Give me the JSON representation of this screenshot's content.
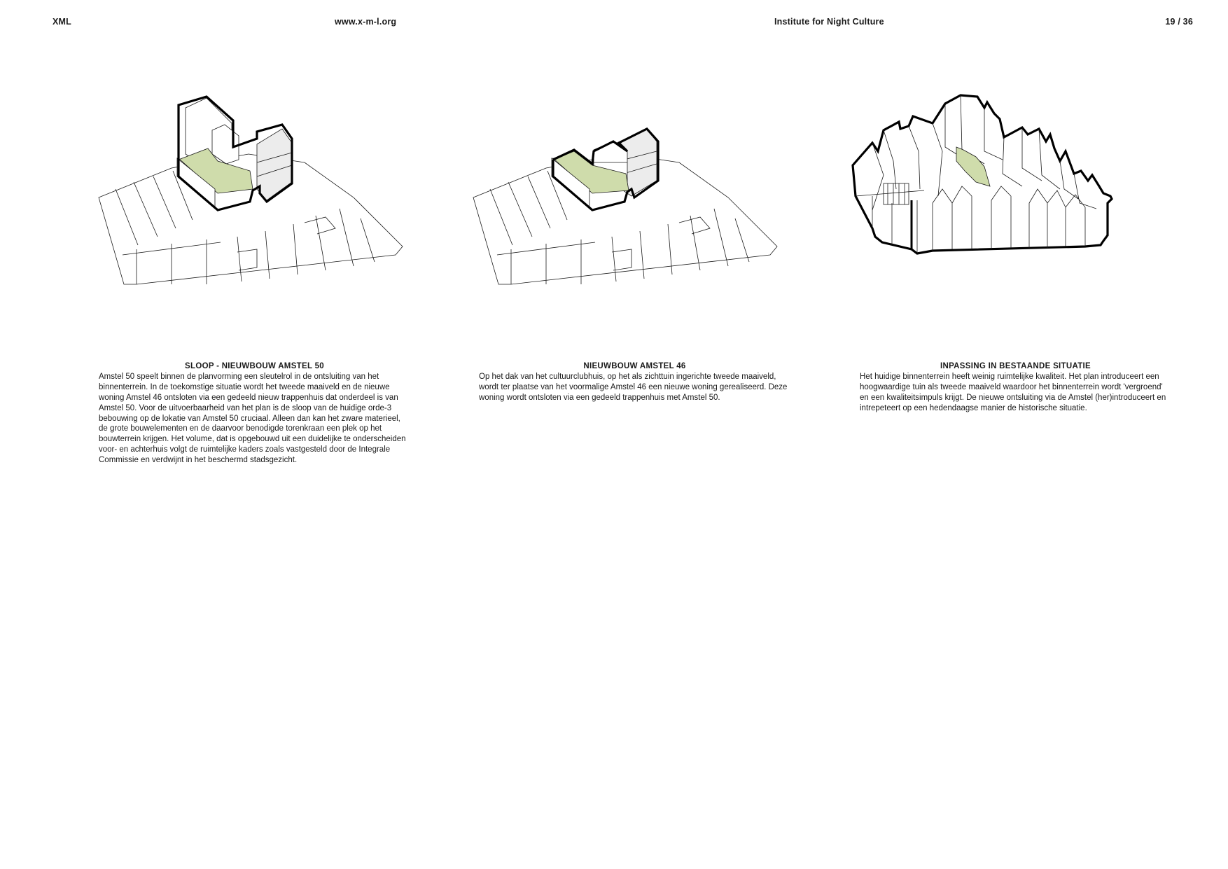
{
  "header": {
    "left": "XML",
    "url": "www.x-m-l.org",
    "institute": "Institute for Night Culture",
    "page": "19 / 36"
  },
  "columns": [
    {
      "title": "SLOOP - NIEUWBOUW AMSTEL 50",
      "text": "Amstel 50 speelt binnen de planvorming een sleutelrol in de ontsluiting van het binnenterrein. In de toekomstige situatie wordt het tweede maaiveld en de nieuwe woning Amstel 46 ontsloten via een gedeeld nieuw trappenhuis dat onderdeel is van Amstel 50. Voor de uitvoerbaarheid van het plan is de sloop van de huidige orde-3 bebouwing op de lokatie van Amstel 50 cruciaal. Alleen dan kan het zware materieel, de grote bouwelementen en de daarvoor benodigde torenkraan een plek op het bouwterrein krijgen. Het volume, dat is opgebouwd uit een duidelijke te onderscheiden voor- en achterhuis volgt de ruimtelijke kaders zoals vastgesteld door de Integrale Commissie en verdwijnt in het beschermd stadsgezicht."
    },
    {
      "title": "NIEUWBOUW AMSTEL 46",
      "text": "Op het dak van het cultuurclubhuis, op het als zichttuin ingerichte tweede maaiveld, wordt ter plaatse van het voormalige Amstel 46 een nieuwe woning gerealiseerd. Deze woning wordt ontsloten via een gedeeld trappenhuis met Amstel 50."
    },
    {
      "title": "INPASSING IN BESTAANDE SITUATIE",
      "text": "Het huidige binnenterrein heeft weinig ruimtelijke kwaliteit. Het plan introduceert een hoogwaardige tuin als tweede maaiveld waardoor het binnenterrein wordt 'vergroend' en een kwaliteitsimpuls krijgt. De nieuwe ontsluiting via de Amstel (her)introduceert en intrepeteert op een hedendaagse manier de historische situatie."
    }
  ],
  "colors": {
    "green_roof": "#cfdcab",
    "line": "#1a1a1a",
    "facade_grey": "#ececec"
  }
}
